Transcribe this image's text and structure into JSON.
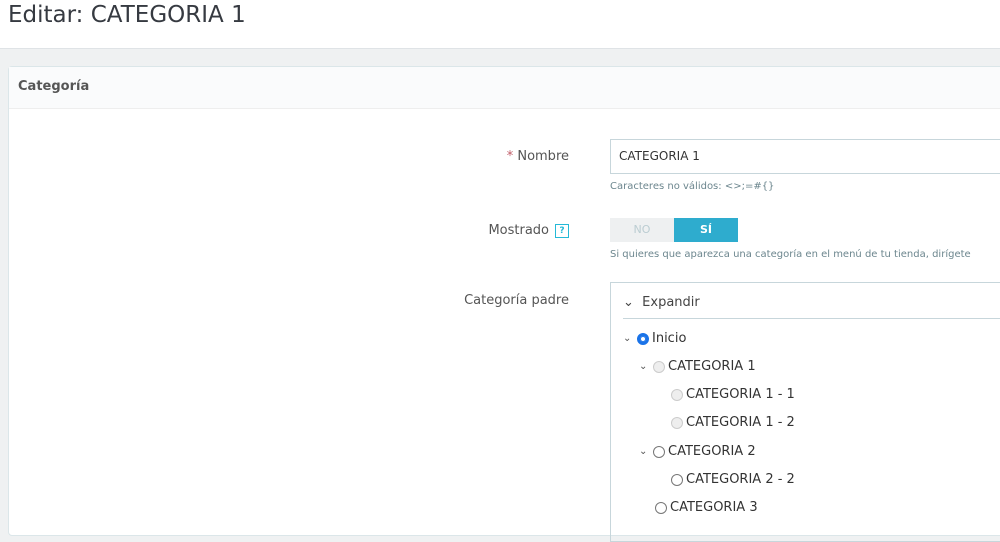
{
  "page_title": "Editar: CATEGORIA 1",
  "panel_title": "Categoría",
  "name": {
    "required_mark": "*",
    "label": "Nombre",
    "value": "CATEGORIA 1",
    "hint": "Caracteres no válidos: <>;=#{}"
  },
  "displayed": {
    "label": "Mostrado",
    "help": "?",
    "no": "NO",
    "yes": "SÍ",
    "selected": "SÍ",
    "hint": "Si quieres que aparezca una categoría en el menú de tu tienda, dirígete"
  },
  "parent": {
    "label": "Categoría padre",
    "expand": "Expandir",
    "nodes": [
      {
        "label": "Inicio",
        "checked": true
      },
      {
        "label": "CATEGORIA 1",
        "disabled": true
      },
      {
        "label": "CATEGORIA 1 - 1",
        "disabled": true
      },
      {
        "label": "CATEGORIA 1 - 2",
        "disabled": true
      },
      {
        "label": "CATEGORIA 2"
      },
      {
        "label": "CATEGORIA 2 - 2"
      },
      {
        "label": "CATEGORIA 3"
      }
    ]
  }
}
